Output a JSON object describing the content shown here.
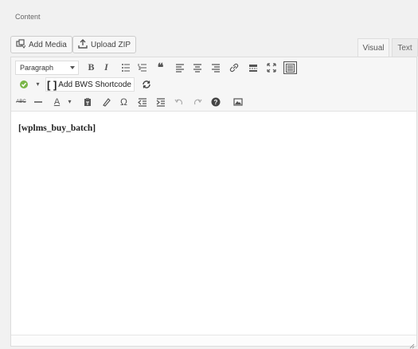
{
  "section": {
    "label": "Content"
  },
  "media_buttons": [
    {
      "label": "Add Media",
      "icon": "add-media-icon"
    },
    {
      "label": "Upload ZIP",
      "icon": "upload-icon"
    }
  ],
  "tabs": {
    "visual": "Visual",
    "text": "Text",
    "active": "Visual"
  },
  "toolbar": {
    "format_select": "Paragraph",
    "row1_icons": [
      "bold-icon",
      "italic-icon",
      "bullet-list-icon",
      "numbered-list-icon",
      "blockquote-icon",
      "align-left-icon",
      "align-center-icon",
      "align-right-icon",
      "link-icon",
      "read-more-icon",
      "fullscreen-icon",
      "toolbar-toggle-icon"
    ],
    "bws_label": "Add BWS Shortcode",
    "row3_icons": [
      "strikethrough-icon",
      "horizontal-line-icon",
      "text-color-icon",
      "paste-text-icon",
      "clear-formatting-icon",
      "special-character-icon",
      "outdent-icon",
      "indent-icon",
      "undo-icon",
      "redo-icon",
      "help-icon",
      "image-icon"
    ]
  },
  "editor": {
    "content": "[wplms_buy_batch]"
  },
  "colors": {
    "accent": "#7ab648",
    "border": "#dcdcdc"
  }
}
